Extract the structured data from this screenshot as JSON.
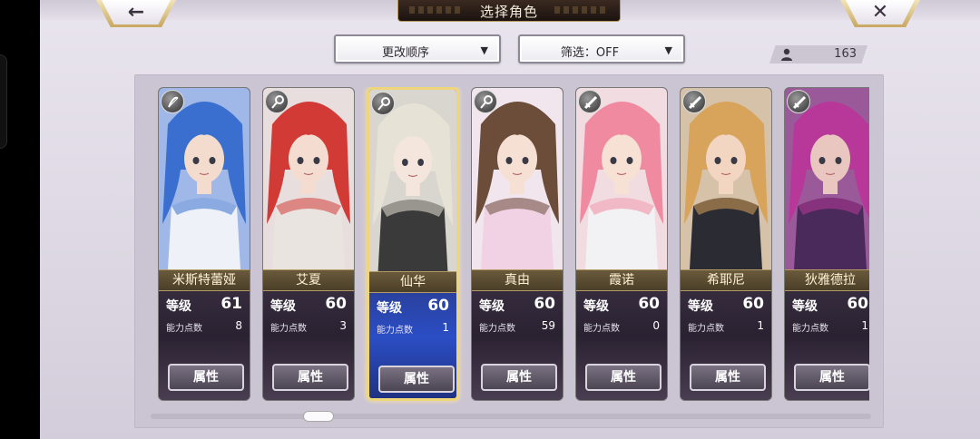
{
  "header": {
    "title": "选择角色",
    "back_glyph": "←",
    "close_glyph": "✕"
  },
  "controls": {
    "sort_label": "更改顺序",
    "filter_label": "筛选：OFF",
    "caret": "▼",
    "character_count": "163"
  },
  "card_labels": {
    "level": "等级",
    "ability_points": "能力点数",
    "attribute_button": "属性"
  },
  "characters": [
    {
      "name": "米斯特蕾娅",
      "level": "61",
      "ability_points": "8",
      "role_icon": "bow-icon",
      "hair": "#3a6fd0",
      "skin": "#f3dccd",
      "outfit": "#eef2f8",
      "bg": "#9fb8e8",
      "selected": false
    },
    {
      "name": "艾夏",
      "level": "60",
      "ability_points": "3",
      "role_icon": "staff-icon",
      "hair": "#d23a36",
      "skin": "#f4ddd0",
      "outfit": "#e9e4e0",
      "bg": "#e8dede",
      "selected": false
    },
    {
      "name": "仙华",
      "level": "60",
      "ability_points": "1",
      "role_icon": "staff-icon",
      "hair": "#e7e2d6",
      "skin": "#f4e6dc",
      "outfit": "#3a3a3a",
      "bg": "#d9d6cf",
      "selected": true
    },
    {
      "name": "真由",
      "level": "60",
      "ability_points": "59",
      "role_icon": "staff-icon",
      "hair": "#6c4d3a",
      "skin": "#f6e0d4",
      "outfit": "#f0d2e4",
      "bg": "#f2e6ee",
      "selected": false
    },
    {
      "name": "霞诺",
      "level": "60",
      "ability_points": "0",
      "role_icon": "sword-icon",
      "hair": "#f08aa0",
      "skin": "#f7e0d4",
      "outfit": "#f2f2f4",
      "bg": "#f1dce2",
      "selected": false
    },
    {
      "name": "希耶尼",
      "level": "60",
      "ability_points": "1",
      "role_icon": "sword-icon",
      "hair": "#d8a35a",
      "skin": "#f2d6c2",
      "outfit": "#2b2b33",
      "bg": "#d6c2a8",
      "selected": false
    },
    {
      "name": "狄雅德拉",
      "level": "60",
      "ability_points": "1",
      "role_icon": "sword-icon",
      "hair": "#b8389a",
      "skin": "#e9c7c0",
      "outfit": "#4a2a5a",
      "bg": "#9a5a9a",
      "selected": false
    }
  ]
}
